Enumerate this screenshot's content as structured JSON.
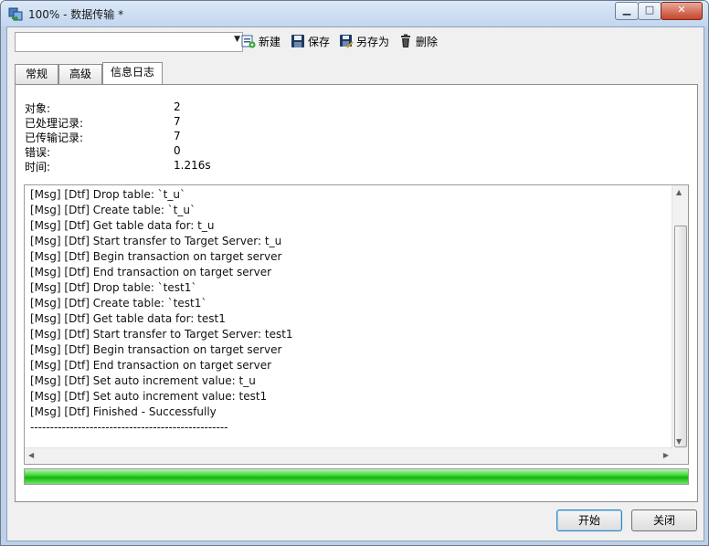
{
  "window": {
    "title": "100% - 数据传输 *",
    "minimize": "▁",
    "maximize": "□",
    "close": "✕"
  },
  "toolbar": {
    "profile_value": "",
    "new_label": "新建",
    "save_label": "保存",
    "save_as_label": "另存为",
    "delete_label": "删除"
  },
  "tabs": [
    {
      "label": "常规",
      "active": false
    },
    {
      "label": "高级",
      "active": false
    },
    {
      "label": "信息日志",
      "active": true
    }
  ],
  "stats": [
    {
      "label": "对象:",
      "value": "2"
    },
    {
      "label": "已处理记录:",
      "value": "7"
    },
    {
      "label": "已传输记录:",
      "value": "7"
    },
    {
      "label": "错误:",
      "value": "0"
    },
    {
      "label": "时间:",
      "value": "1.216s"
    }
  ],
  "log_lines": [
    "[Msg] [Dtf] Drop table: `t_u`",
    "[Msg] [Dtf] Create table: `t_u`",
    "[Msg] [Dtf] Get table data for: t_u",
    "[Msg] [Dtf] Start transfer to Target Server: t_u",
    "[Msg] [Dtf] Begin transaction on target server",
    "[Msg] [Dtf] End transaction on target server",
    "[Msg] [Dtf] Drop table: `test1`",
    "[Msg] [Dtf] Create table: `test1`",
    "[Msg] [Dtf] Get table data for: test1",
    "[Msg] [Dtf] Start transfer to Target Server: test1",
    "[Msg] [Dtf] Begin transaction on target server",
    "[Msg] [Dtf] End transaction on target server",
    "[Msg] [Dtf] Set auto increment value: t_u",
    "[Msg] [Dtf] Set auto increment value: test1",
    "[Msg] [Dtf] Finished - Successfully",
    "--------------------------------------------------"
  ],
  "progress": {
    "percent": 100,
    "color": "#22c418"
  },
  "buttons": {
    "start_label": "开始",
    "close_label": "关闭"
  }
}
